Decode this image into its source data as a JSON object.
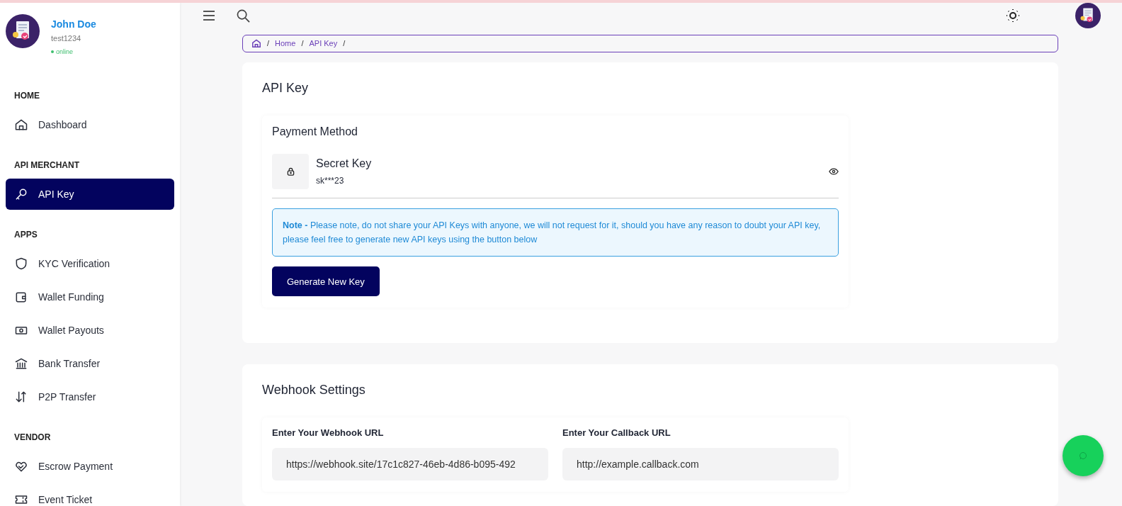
{
  "user": {
    "name": "John Doe",
    "username": "test1234",
    "status": "online"
  },
  "sidebar": {
    "sections": [
      {
        "title": "HOME",
        "items": [
          {
            "label": "Dashboard",
            "selected": false
          }
        ]
      },
      {
        "title": "API MERCHANT",
        "items": [
          {
            "label": "API Key",
            "selected": true
          }
        ]
      },
      {
        "title": "APPS",
        "items": [
          {
            "label": "KYC Verification",
            "selected": false
          },
          {
            "label": "Wallet Funding",
            "selected": false
          },
          {
            "label": "Wallet Payouts",
            "selected": false
          },
          {
            "label": "Bank Transfer",
            "selected": false
          },
          {
            "label": "P2P Transfer",
            "selected": false
          }
        ]
      },
      {
        "title": "VENDOR",
        "items": [
          {
            "label": "Escrow Payment",
            "selected": false
          },
          {
            "label": "Event Ticket",
            "selected": false
          }
        ]
      }
    ]
  },
  "breadcrumb": [
    {
      "kind": "separator",
      "text": "/"
    },
    {
      "kind": "link",
      "text": "Home"
    },
    {
      "kind": "separator",
      "text": "/"
    },
    {
      "kind": "link",
      "text": "API Key"
    },
    {
      "kind": "separator",
      "text": "/"
    }
  ],
  "api_card": {
    "title": "API Key",
    "subtitle": "Payment Method",
    "key_label": "Secret Key",
    "key_value": "sk***23",
    "note_label": "Note -",
    "note_text": "Please note, do not share your API Keys with anyone, we will not request for it, should you have any reason to doubt your API key, please feel free to generate new API keys using the button below",
    "button": "Generate New Key"
  },
  "webhook_card": {
    "title": "Webhook Settings",
    "fields": [
      {
        "label": "Enter Your Webhook URL",
        "value": "https://webhook.site/17c1c827-46eb-4d86-b095-492"
      },
      {
        "label": "Enter Your Callback URL",
        "value": "http://example.callback.com"
      }
    ]
  }
}
